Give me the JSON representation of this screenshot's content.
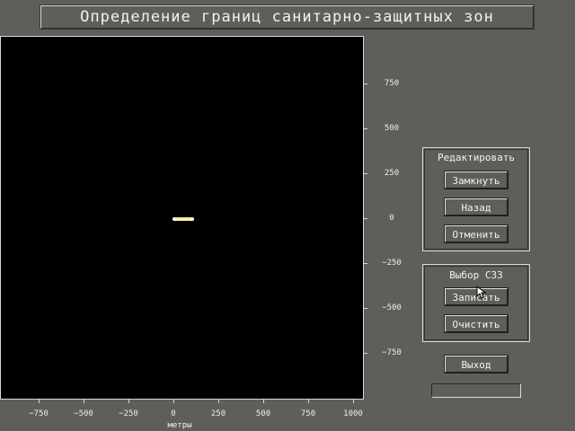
{
  "window": {
    "title": "Определение границ санитарно-защитных зон"
  },
  "plot": {
    "y_ticks": [
      "750",
      "500",
      "250",
      "0",
      "−250",
      "−500",
      "−750"
    ],
    "x_ticks": [
      "−750",
      "−500",
      "−250",
      "0",
      "250",
      "500",
      "750",
      "1000"
    ],
    "xlabel": "метры",
    "segment": {
      "x_from": 0,
      "x_to": 100,
      "y": 0,
      "color": "#f4efa0"
    }
  },
  "edit_group": {
    "title": "Редактировать",
    "close_label": "Замкнуть",
    "back_label": "Назад",
    "cancel_label": "Отменить"
  },
  "szz_group": {
    "title": "Выбор СЗЗ",
    "save_label": "Записать",
    "clear_label": "Очистить"
  },
  "exit_label": "Выход",
  "status": ""
}
